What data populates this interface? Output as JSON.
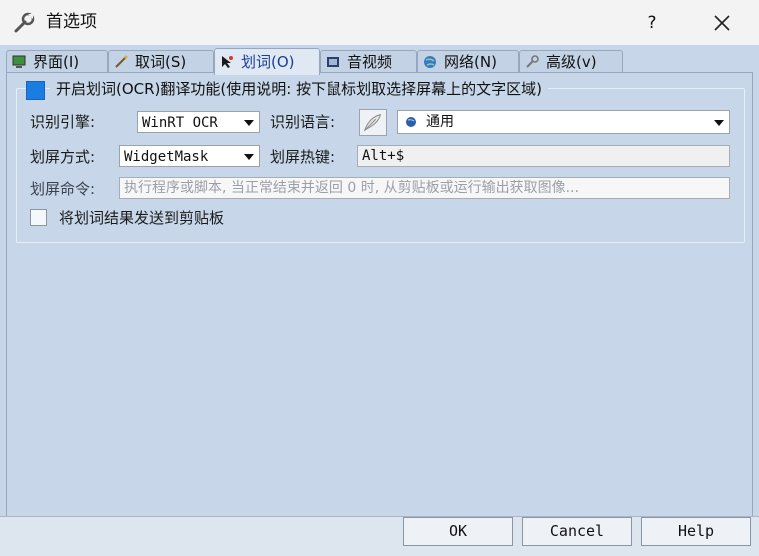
{
  "window": {
    "title": "首选项",
    "help_label": "?"
  },
  "tabs": [
    {
      "label": "界面(I)",
      "icon": "monitor-icon"
    },
    {
      "label": "取词(S)",
      "icon": "wand-icon"
    },
    {
      "label": "划词(O)",
      "icon": "cursor-icon",
      "active": true
    },
    {
      "label": "音视频",
      "icon": "film-icon"
    },
    {
      "label": "网络(N)",
      "icon": "globe-icon"
    },
    {
      "label": "高级(v)",
      "icon": "wrench-icon"
    }
  ],
  "ocr": {
    "enable_label": "开启划词(OCR)翻译功能(使用说明: 按下鼠标划取选择屏幕上的文字区域)",
    "enabled": true,
    "engine_label": "识别引擎:",
    "engine_value": "WinRT OCR",
    "language_label": "识别语言:",
    "language_value": "通用",
    "mode_label": "划屏方式:",
    "mode_value": "WidgetMask",
    "hotkey_label": "划屏热键:",
    "hotkey_value": "Alt+$",
    "command_label": "划屏命令:",
    "command_placeholder": "执行程序或脚本, 当正常结束并返回 0 时, 从剪贴板或运行输出获取图像...",
    "copy_label": "将划词结果发送到剪贴板",
    "copy_enabled": false
  },
  "buttons": {
    "ok": "OK",
    "cancel": "Cancel",
    "help": "Help"
  },
  "colors": {
    "panel_bg": "#c7d7e9",
    "checkbox_checked": "#1c7de0"
  }
}
